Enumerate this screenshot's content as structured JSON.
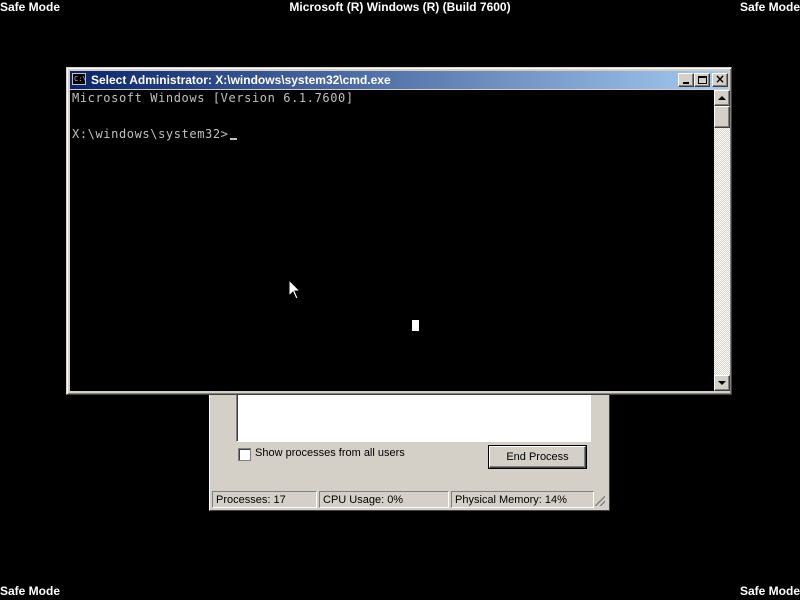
{
  "desktop": {
    "safe_mode_label": "Safe Mode",
    "build_text": "Microsoft (R) Windows (R) (Build 7600)",
    "background_color": "#000000"
  },
  "cmd_window": {
    "title": "Select Administrator: X:\\windows\\system32\\cmd.exe",
    "icon": "cmd-icon",
    "icon_glyph": "C:\\",
    "console_lines": [
      "Microsoft Windows [Version 6.1.7600]",
      "X:\\windows\\system32>"
    ],
    "titlebar_color": "#0a246a",
    "console_bg": "#000000",
    "console_fg": "#c0c0c0"
  },
  "task_manager": {
    "checkbox_label": "Show processes from all users",
    "checkbox_checked": false,
    "end_process_label": "End Process",
    "status": {
      "processes": "Processes: 17",
      "cpu": "CPU Usage: 0%",
      "memory": "Physical Memory: 14%"
    }
  }
}
